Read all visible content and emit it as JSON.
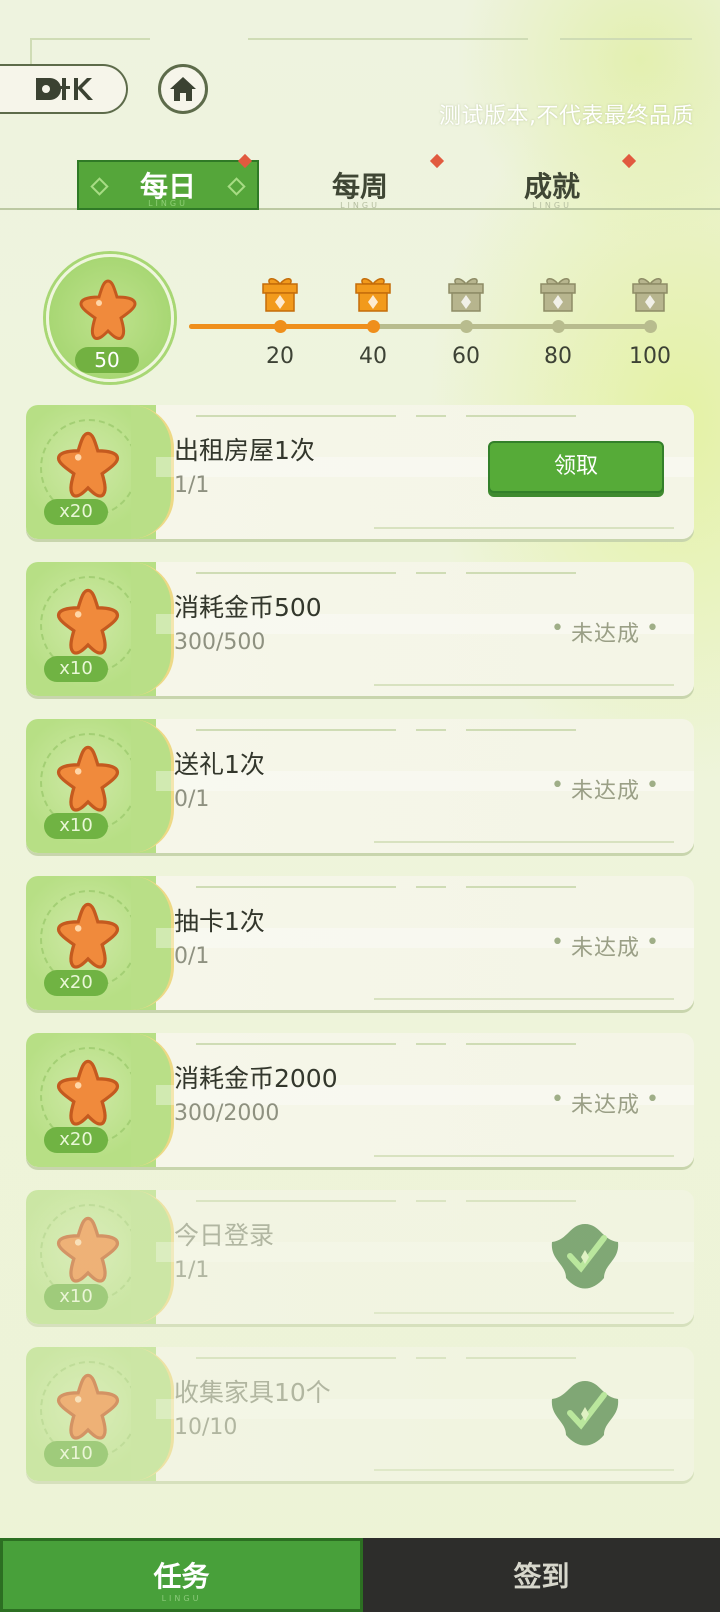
{
  "top": {
    "back_logo": "KIK",
    "test_note": "测试版本,不代表最终品质"
  },
  "tabs": [
    {
      "label": "每日",
      "sub": "LINGU",
      "active": true,
      "has_dot": true
    },
    {
      "label": "每周",
      "sub": "LINGU",
      "active": false,
      "has_dot": true
    },
    {
      "label": "成就",
      "sub": "LINGU",
      "active": false,
      "has_dot": true
    }
  ],
  "progress": {
    "current": "50",
    "milestones": [
      {
        "value": "20",
        "reached": true
      },
      {
        "value": "40",
        "reached": true
      },
      {
        "value": "60",
        "reached": false
      },
      {
        "value": "80",
        "reached": false
      },
      {
        "value": "100",
        "reached": false
      }
    ],
    "fill_fraction": 0.5
  },
  "tasks": [
    {
      "title": "出租房屋1次",
      "progress": "1/1",
      "reward": "x20",
      "state": "claimable",
      "action_label": "领取"
    },
    {
      "title": "消耗金币500",
      "progress": "300/500",
      "reward": "x10",
      "state": "incomplete",
      "status_label": "未达成"
    },
    {
      "title": "送礼1次",
      "progress": "0/1",
      "reward": "x10",
      "state": "incomplete",
      "status_label": "未达成"
    },
    {
      "title": "抽卡1次",
      "progress": "0/1",
      "reward": "x20",
      "state": "incomplete",
      "status_label": "未达成"
    },
    {
      "title": "消耗金币2000",
      "progress": "300/2000",
      "reward": "x20",
      "state": "incomplete",
      "status_label": "未达成"
    },
    {
      "title": "今日登录",
      "progress": "1/1",
      "reward": "x10",
      "state": "done"
    },
    {
      "title": "收集家具10个",
      "progress": "10/10",
      "reward": "x10",
      "state": "done"
    }
  ],
  "bottom_nav": {
    "task_label": "任务",
    "task_sub": "LINGU",
    "signin_label": "签到"
  },
  "colors": {
    "accent_green": "#55a63a",
    "progress_orange": "#ef8f1c",
    "badge_red": "#e15a3f",
    "star_orange": "#f08a3c"
  }
}
